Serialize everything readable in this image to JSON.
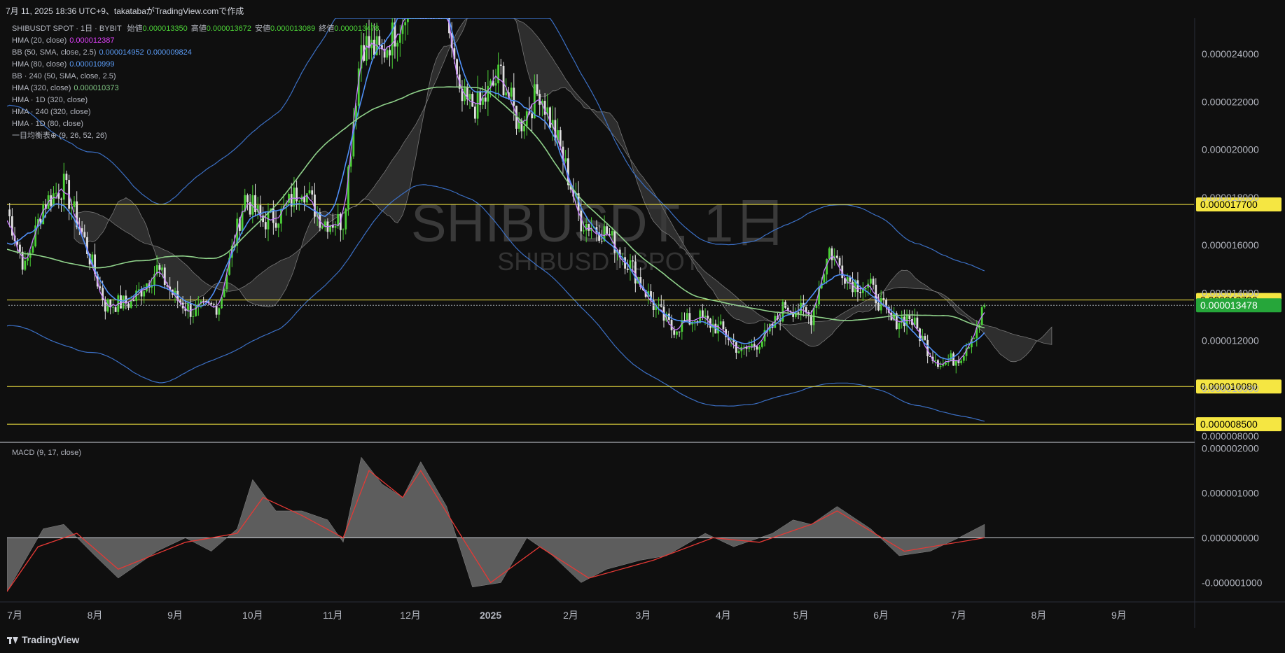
{
  "header": {
    "timestamp_line": "7月 11, 2025 18:36 UTC+9、takatabaがTradingView.comで作成"
  },
  "legend": {
    "symbol_line": "SHIBUSDT SPOT · 1日 · BYBIT",
    "ohlc": [
      {
        "label": "始値",
        "value": "0.000013350"
      },
      {
        "label": "高値",
        "value": "0.000013672"
      },
      {
        "label": "安値",
        "value": "0.000013089"
      },
      {
        "label": "終値",
        "value": "0.000013478"
      }
    ],
    "indicators": [
      {
        "name": "HMA (20, close)",
        "values": [
          "0.000012387"
        ],
        "color": "#e040fb"
      },
      {
        "name": "BB (50, SMA, close, 2.5)",
        "values": [
          "0.000014952",
          "0.000009824"
        ],
        "color": "#5b9cf6"
      },
      {
        "name": "HMA (80, close)",
        "values": [
          "0.000010999"
        ],
        "color": "#5b9cf6"
      },
      {
        "name": "BB · 240 (50, SMA, close, 2.5)",
        "values": [],
        "color": ""
      },
      {
        "name": "HMA (320, close)",
        "values": [
          "0.000010373"
        ],
        "color": "#81c784"
      },
      {
        "name": "HMA · 1D (320, close)",
        "values": [],
        "color": ""
      },
      {
        "name": "HMA · 240 (320, close)",
        "values": [],
        "color": ""
      },
      {
        "name": "HMA · 1D (80, close)",
        "values": [],
        "color": ""
      },
      {
        "name": "一目均衡表⊕ (9, 26, 52, 26)",
        "values": [],
        "color": ""
      }
    ],
    "macd_label": "MACD (9, 17, close)"
  },
  "watermark": {
    "main": "SHIBUSDT, 1日",
    "sub": "SHIBUSDT SPOT"
  },
  "footer": {
    "brand": "TradingView"
  },
  "colors": {
    "background": "#0f0f0f",
    "up": "#4cd137",
    "down": "#e0e0e0",
    "hma20": "#c77dff",
    "hma80": "#4f8ff7",
    "hma320": "#8fd18a",
    "bands": "#3b6fc4",
    "cloud": "#3a3a3a",
    "hline": "#f5e642",
    "macd_hist": "#6b6b6b",
    "macd_signal": "#e53935",
    "last_price_bg": "#26a63a"
  },
  "chart_data": [
    {
      "type": "candlestick",
      "title": "SHIBUSDT SPOT · 1日 · BYBIT",
      "price_axis": {
        "ylim": [
          7.8e-06,
          2.55e-05
        ],
        "ticks": [
          "0.000008000",
          "0.000010000",
          "0.000012000",
          "0.000014000",
          "0.000016000",
          "0.000018000",
          "0.000020000",
          "0.000022000",
          "0.000024000"
        ]
      },
      "time_axis": {
        "labels": [
          {
            "label": "7月",
            "date": "2024-07-01"
          },
          {
            "label": "8月",
            "date": "2024-08-01"
          },
          {
            "label": "9月",
            "date": "2024-09-01"
          },
          {
            "label": "10月",
            "date": "2024-10-01"
          },
          {
            "label": "11月",
            "date": "2024-11-01"
          },
          {
            "label": "12月",
            "date": "2024-12-01"
          },
          {
            "label": "2025",
            "date": "2025-01-01"
          },
          {
            "label": "2月",
            "date": "2025-02-01"
          },
          {
            "label": "3月",
            "date": "2025-03-01"
          },
          {
            "label": "4月",
            "date": "2025-04-01"
          },
          {
            "label": "5月",
            "date": "2025-05-01"
          },
          {
            "label": "6月",
            "date": "2025-06-01"
          },
          {
            "label": "7月",
            "date": "2025-07-01"
          },
          {
            "label": "8月",
            "date": "2025-08-01"
          },
          {
            "label": "9月",
            "date": "2025-09-01"
          }
        ],
        "range": [
          "2024-06-28",
          "2025-09-30"
        ]
      },
      "horizontal_levels": [
        {
          "price": 1.77e-05,
          "label": "0.000017700"
        },
        {
          "price": 1.37e-05,
          "label": "0.000013700"
        },
        {
          "price": 1.008e-05,
          "label": "0.000010080"
        },
        {
          "price": 8.5e-06,
          "label": "0.000008500"
        }
      ],
      "last_price": {
        "price": 1.3478e-05,
        "label": "0.000013478"
      },
      "close_path": [
        [
          "2024-06-28",
          1.75e-05
        ],
        [
          "2024-07-05",
          1.5e-05
        ],
        [
          "2024-07-12",
          1.77e-05
        ],
        [
          "2024-07-20",
          1.85e-05
        ],
        [
          "2024-07-27",
          1.65e-05
        ],
        [
          "2024-08-05",
          1.35e-05
        ],
        [
          "2024-08-15",
          1.36e-05
        ],
        [
          "2024-08-25",
          1.5e-05
        ],
        [
          "2024-09-01",
          1.38e-05
        ],
        [
          "2024-09-08",
          1.32e-05
        ],
        [
          "2024-09-18",
          1.35e-05
        ],
        [
          "2024-09-28",
          1.8e-05
        ],
        [
          "2024-10-05",
          1.7e-05
        ],
        [
          "2024-10-12",
          1.73e-05
        ],
        [
          "2024-10-20",
          1.85e-05
        ],
        [
          "2024-10-28",
          1.7e-05
        ],
        [
          "2024-11-05",
          1.7e-05
        ],
        [
          "2024-11-12",
          2.45e-05
        ],
        [
          "2024-11-20",
          2.4e-05
        ],
        [
          "2024-11-28",
          2.55e-05
        ],
        [
          "2024-12-05",
          2.95e-05
        ],
        [
          "2024-12-12",
          2.8e-05
        ],
        [
          "2024-12-20",
          2.2e-05
        ],
        [
          "2024-12-28",
          2.18e-05
        ],
        [
          "2025-01-05",
          2.32e-05
        ],
        [
          "2025-01-12",
          2.1e-05
        ],
        [
          "2025-01-20",
          2.25e-05
        ],
        [
          "2025-01-28",
          2e-05
        ],
        [
          "2025-02-05",
          1.7e-05
        ],
        [
          "2025-02-15",
          1.65e-05
        ],
        [
          "2025-02-25",
          1.5e-05
        ],
        [
          "2025-03-05",
          1.35e-05
        ],
        [
          "2025-03-12",
          1.25e-05
        ],
        [
          "2025-03-22",
          1.3e-05
        ],
        [
          "2025-04-01",
          1.24e-05
        ],
        [
          "2025-04-08",
          1.15e-05
        ],
        [
          "2025-04-18",
          1.22e-05
        ],
        [
          "2025-04-25",
          1.35e-05
        ],
        [
          "2025-05-05",
          1.3e-05
        ],
        [
          "2025-05-12",
          1.58e-05
        ],
        [
          "2025-05-20",
          1.45e-05
        ],
        [
          "2025-05-28",
          1.42e-05
        ],
        [
          "2025-06-05",
          1.28e-05
        ],
        [
          "2025-06-12",
          1.3e-05
        ],
        [
          "2025-06-20",
          1.15e-05
        ],
        [
          "2025-06-25",
          1.1e-05
        ],
        [
          "2025-07-02",
          1.14e-05
        ],
        [
          "2025-07-09",
          1.28e-05
        ],
        [
          "2025-07-11",
          1.35e-05
        ]
      ],
      "series": [
        {
          "name": "HMA (20, close)",
          "style": "hma20"
        },
        {
          "name": "HMA (80, close)",
          "style": "hma80"
        },
        {
          "name": "HMA (320, close)",
          "style": "hma320"
        },
        {
          "name": "BB (50, SMA, close, 2.5)",
          "style": "bands"
        },
        {
          "name": "一目均衡表⊕ (9, 26, 52, 26)",
          "style": "cloud"
        }
      ]
    },
    {
      "type": "area",
      "title": "MACD (9, 17, close)",
      "ylim": [
        -1.4e-06,
        2.1e-06
      ],
      "ticks": [
        "0.000002000",
        "0.000001000",
        "0.000000000",
        "-0.000001000"
      ],
      "histogram": [
        [
          "2024-06-28",
          -1.2e-06
        ],
        [
          "2024-07-05",
          -5e-07
        ],
        [
          "2024-07-12",
          2e-07
        ],
        [
          "2024-07-20",
          3e-07
        ],
        [
          "2024-08-01",
          -4e-07
        ],
        [
          "2024-08-10",
          -9e-07
        ],
        [
          "2024-08-25",
          -3e-07
        ],
        [
          "2024-09-05",
          0.0
        ],
        [
          "2024-09-15",
          -3e-07
        ],
        [
          "2024-09-25",
          2e-07
        ],
        [
          "2024-10-01",
          1.3e-06
        ],
        [
          "2024-10-10",
          6e-07
        ],
        [
          "2024-10-20",
          6e-07
        ],
        [
          "2024-10-30",
          4e-07
        ],
        [
          "2024-11-05",
          -1e-07
        ],
        [
          "2024-11-12",
          1.8e-06
        ],
        [
          "2024-11-20",
          1.2e-06
        ],
        [
          "2024-11-28",
          9e-07
        ],
        [
          "2024-12-05",
          1.7e-06
        ],
        [
          "2024-12-15",
          7e-07
        ],
        [
          "2024-12-25",
          -1.1e-06
        ],
        [
          "2025-01-05",
          -1e-06
        ],
        [
          "2025-01-15",
          0.0
        ],
        [
          "2025-01-25",
          -4e-07
        ],
        [
          "2025-02-05",
          -1e-06
        ],
        [
          "2025-02-15",
          -7e-07
        ],
        [
          "2025-02-28",
          -5e-07
        ],
        [
          "2025-03-10",
          -4e-07
        ],
        [
          "2025-03-25",
          1e-07
        ],
        [
          "2025-04-05",
          -2e-07
        ],
        [
          "2025-04-20",
          1e-07
        ],
        [
          "2025-04-28",
          4e-07
        ],
        [
          "2025-05-05",
          3e-07
        ],
        [
          "2025-05-15",
          7e-07
        ],
        [
          "2025-05-28",
          2e-07
        ],
        [
          "2025-06-08",
          -4e-07
        ],
        [
          "2025-06-20",
          -3e-07
        ],
        [
          "2025-07-01",
          0.0
        ],
        [
          "2025-07-11",
          3e-07
        ]
      ],
      "signal": [
        [
          "2024-06-28",
          -1.2e-06
        ],
        [
          "2024-07-10",
          -2e-07
        ],
        [
          "2024-07-25",
          1e-07
        ],
        [
          "2024-08-10",
          -7e-07
        ],
        [
          "2024-09-05",
          -1e-07
        ],
        [
          "2024-09-25",
          1e-07
        ],
        [
          "2024-10-05",
          9e-07
        ],
        [
          "2024-10-20",
          5e-07
        ],
        [
          "2024-11-05",
          0.0
        ],
        [
          "2024-11-15",
          1.5e-06
        ],
        [
          "2024-11-28",
          9e-07
        ],
        [
          "2024-12-05",
          1.5e-06
        ],
        [
          "2024-12-20",
          1e-07
        ],
        [
          "2025-01-01",
          -1e-06
        ],
        [
          "2025-01-20",
          -2e-07
        ],
        [
          "2025-02-08",
          -9e-07
        ],
        [
          "2025-03-05",
          -5e-07
        ],
        [
          "2025-03-28",
          0.0
        ],
        [
          "2025-04-15",
          -1e-07
        ],
        [
          "2025-05-05",
          3e-07
        ],
        [
          "2025-05-15",
          6e-07
        ],
        [
          "2025-06-10",
          -3e-07
        ],
        [
          "2025-07-11",
          0.0
        ]
      ]
    }
  ]
}
